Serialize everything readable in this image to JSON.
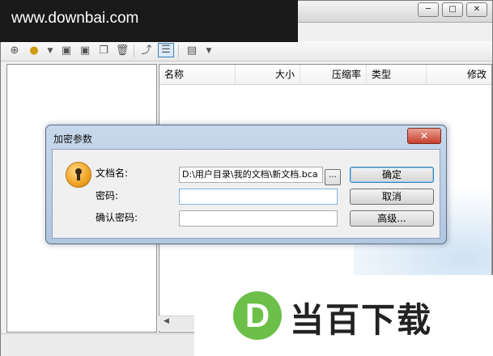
{
  "watermark_top": "www.downbai.com",
  "window": {
    "controls": {
      "minimize": "─",
      "maximize": "□",
      "close": "✕"
    }
  },
  "toolbar": {
    "icons": [
      "add-icon",
      "open-icon",
      "dropdown-arrow-icon",
      "new-file-icon",
      "new-folder-icon",
      "copy-icon",
      "delete-icon",
      "up-folder-icon",
      "details-view-icon",
      "list-view-icon",
      "view-dropdown-icon"
    ]
  },
  "file_list": {
    "columns": [
      "名称",
      "大小",
      "压缩率",
      "类型",
      "修改"
    ]
  },
  "dialog": {
    "title": "加密参数",
    "close": "✕",
    "filename_label": "文档名:",
    "filename_value": "D:\\用户目录\\我的文档\\新文档.bca",
    "browse_label": "...",
    "password_label": "密码:",
    "password_value": "",
    "confirm_label": "确认密码:",
    "confirm_value": "",
    "ok_button": "确定",
    "cancel_button": "取消",
    "advanced_button": "高级..."
  },
  "brand": {
    "logo_letter": "D",
    "name": "当百下载"
  },
  "colors": {
    "dialog_frame": "#b1c7e0",
    "close_button": "#c7402c",
    "brand_green": "#6cc04a"
  }
}
